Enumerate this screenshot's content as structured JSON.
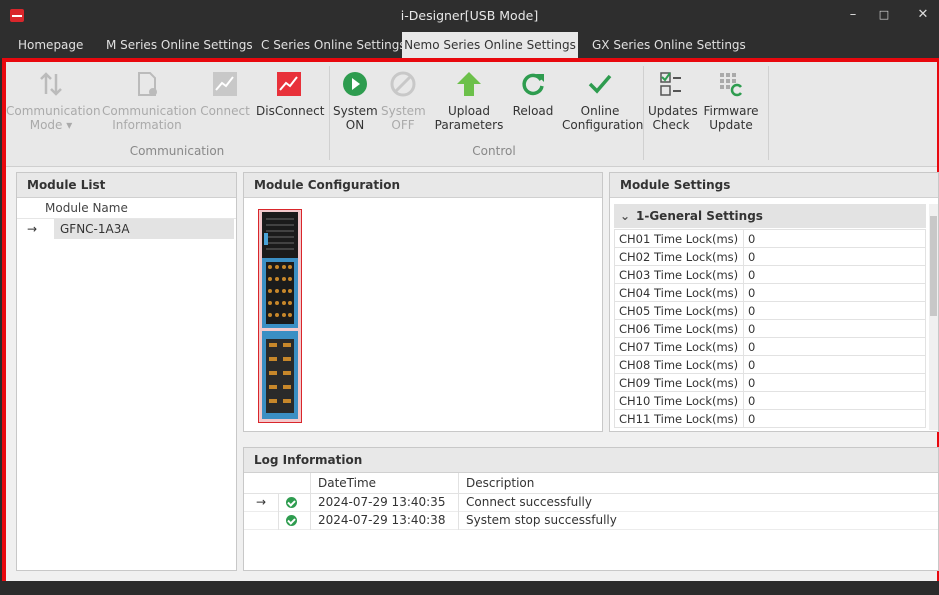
{
  "window": {
    "title": "i-Designer[USB Mode]"
  },
  "tabs": [
    "Homepage",
    "M Series Online Settings",
    "C Series Online Settings",
    "Nemo Series Online Settings",
    "GX Series Online Settings"
  ],
  "ribbon": {
    "communication_mode": "Communication\nMode ▾",
    "communication_info": "Communication\nInformation",
    "connect": "Connect",
    "disconnect": "DisConnect",
    "system_on": "System\nON",
    "system_off": "System\nOFF",
    "upload": "Upload\nParameters",
    "reload": "Reload",
    "online_config": "Online\nConfiguration",
    "updates_check": "Updates\nCheck",
    "firmware_update": "Firmware\nUpdate",
    "group_communication": "Communication",
    "group_control": "Control"
  },
  "module_list": {
    "title": "Module List",
    "column": "Module Name",
    "items": [
      "GFNC-1A3A"
    ],
    "arrow": "→"
  },
  "module_config": {
    "title": "Module Configuration"
  },
  "module_settings": {
    "title": "Module Settings",
    "group": "1-General Settings",
    "chevron": "⌄",
    "rows": [
      {
        "name": "CH01 Time Lock(ms)",
        "value": "0"
      },
      {
        "name": "CH02 Time Lock(ms)",
        "value": "0"
      },
      {
        "name": "CH03 Time Lock(ms)",
        "value": "0"
      },
      {
        "name": "CH04 Time Lock(ms)",
        "value": "0"
      },
      {
        "name": "CH05 Time Lock(ms)",
        "value": "0"
      },
      {
        "name": "CH06 Time Lock(ms)",
        "value": "0"
      },
      {
        "name": "CH07 Time Lock(ms)",
        "value": "0"
      },
      {
        "name": "CH08 Time Lock(ms)",
        "value": "0"
      },
      {
        "name": "CH09 Time Lock(ms)",
        "value": "0"
      },
      {
        "name": "CH10 Time Lock(ms)",
        "value": "0"
      },
      {
        "name": "CH11 Time Lock(ms)",
        "value": "0"
      }
    ]
  },
  "log": {
    "title": "Log Information",
    "col_datetime": "DateTime",
    "col_description": "Description",
    "arrow": "→",
    "rows": [
      {
        "datetime": "2024-07-29 13:40:35",
        "description": "Connect successfully"
      },
      {
        "datetime": "2024-07-29 13:40:38",
        "description": "System stop successfully"
      }
    ]
  },
  "colors": {
    "accent_red": "#e8080e",
    "success_green": "#2e9c4f",
    "upload_green": "#6cc04a"
  }
}
